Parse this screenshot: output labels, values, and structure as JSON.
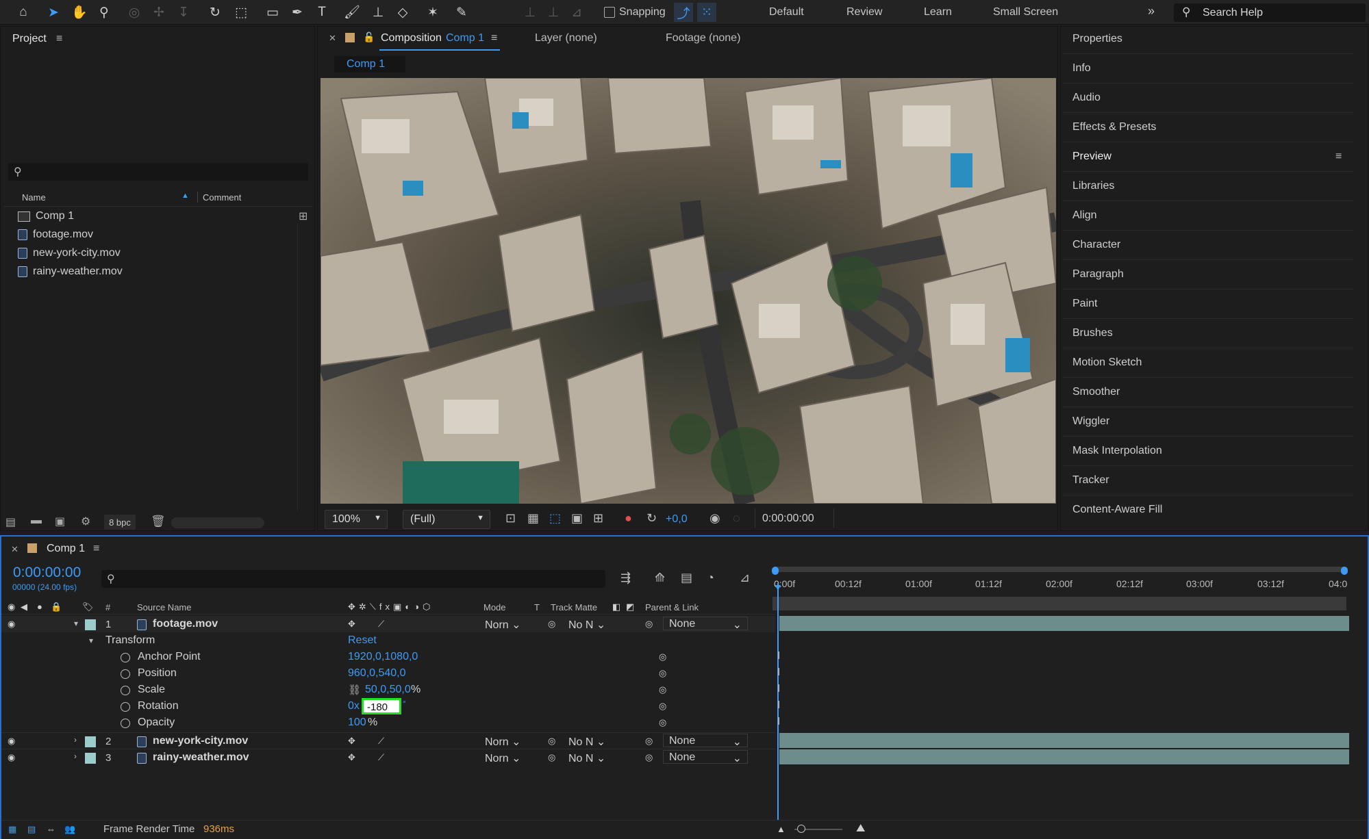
{
  "toolbar": {
    "snapping_label": "Snapping",
    "workspaces": [
      "Default",
      "Review",
      "Learn",
      "Small Screen"
    ],
    "search_placeholder": "Search Help",
    "tools": [
      "home-icon",
      "selection-icon",
      "hand-icon",
      "zoom-icon",
      "orbit-icon",
      "pan-icon",
      "dolly-icon",
      "rotate-icon",
      "pan-behind-icon",
      "rectangle-icon",
      "pen-icon",
      "type-icon",
      "brush-icon",
      "clone-stamp-icon",
      "eraser-icon",
      "roto-brush-icon",
      "puppet-icon"
    ]
  },
  "project": {
    "title": "Project",
    "search_placeholder": "",
    "col_name": "Name",
    "col_comment": "Comment",
    "items": [
      "Comp 1",
      "footage.mov",
      "new-york-city.mov",
      "rainy-weather.mov"
    ],
    "bpc": "8 bpc"
  },
  "comp_panel": {
    "tab_label": "Composition",
    "tab_comp": "Comp 1",
    "layer_tab": "Layer (none)",
    "footage_tab": "Footage (none)",
    "sub_tab": "Comp 1",
    "zoom": "100%",
    "resolution": "(Full)",
    "exposure": "+0,0",
    "timecode": "0:00:00:00"
  },
  "right_panel": {
    "items": [
      "Properties",
      "Info",
      "Audio",
      "Effects & Presets",
      "Preview",
      "Libraries",
      "Align",
      "Character",
      "Paragraph",
      "Paint",
      "Brushes",
      "Motion Sketch",
      "Smoother",
      "Wiggler",
      "Mask Interpolation",
      "Tracker",
      "Content-Aware Fill"
    ]
  },
  "timeline": {
    "comp_tab": "Comp 1",
    "timecode": "0:00:00:00",
    "frame_info": "00000 (24.00 fps)",
    "headers": {
      "hash": "#",
      "source": "Source Name",
      "mode": "Mode",
      "t": "T",
      "matte": "Track Matte",
      "parent": "Parent & Link"
    },
    "ruler": [
      "0:00f",
      "00:12f",
      "01:00f",
      "01:12f",
      "02:00f",
      "02:12f",
      "03:00f",
      "03:12f",
      "04:0"
    ],
    "layers": [
      {
        "num": "1",
        "name": "footage.mov",
        "mode": "Norn",
        "matte": "No N",
        "parent": "None"
      },
      {
        "num": "2",
        "name": "new-york-city.mov",
        "mode": "Norn",
        "matte": "No N",
        "parent": "None"
      },
      {
        "num": "3",
        "name": "rainy-weather.mov",
        "mode": "Norn",
        "matte": "No N",
        "parent": "None"
      }
    ],
    "transform": {
      "label": "Transform",
      "reset": "Reset",
      "anchor_label": "Anchor Point",
      "anchor_value": "1920,0,1080,0",
      "position_label": "Position",
      "position_value": "960,0,540,0",
      "scale_label": "Scale",
      "scale_value": "50,0,50,0",
      "scale_unit": "%",
      "rotation_label": "Rotation",
      "rotation_prefix": "0x",
      "rotation_value": "-180",
      "rotation_unit": "°",
      "opacity_label": "Opacity",
      "opacity_value": "100",
      "opacity_unit": "%"
    },
    "footer_label": "Frame Render Time",
    "footer_value": "936ms"
  },
  "colors": {
    "accent": "#3d9bf5",
    "highlight": "#21e021",
    "layer_bar": "#6d8d8d",
    "render_time": "#e8a33a"
  }
}
